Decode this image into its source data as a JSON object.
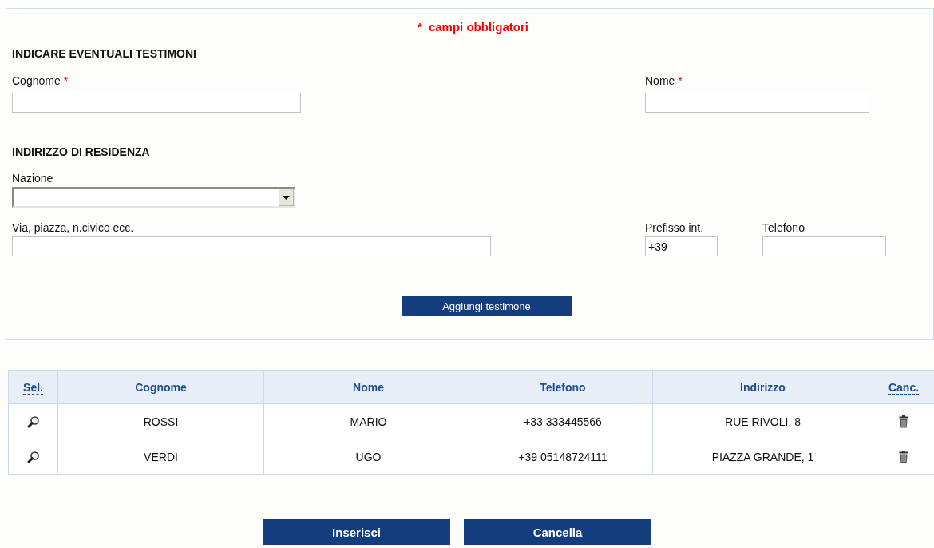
{
  "required_note": {
    "mark": "*",
    "text": "campi obbligatori"
  },
  "witness_section": {
    "title": "INDICARE EVENTUALI TESTIMONI",
    "fields": [
      {
        "label": "Cognome",
        "required_mark": "*",
        "kind": "text"
      },
      {
        "label": "Nome",
        "required_mark": "*",
        "kind": "text"
      }
    ]
  },
  "address_section": {
    "title": "INDIRIZZO DI RESIDENZA",
    "fields": [
      {
        "label": "Nazione",
        "kind": "select"
      },
      {
        "label": "Via, piazza, n.civico ecc.",
        "kind": "text"
      },
      {
        "label": "Prefisso int.",
        "kind": "text",
        "value": "+39"
      },
      {
        "label": "Telefono",
        "kind": "text"
      }
    ]
  },
  "add_button": "Aggiungi testimone",
  "table": {
    "columns": [
      {
        "label": "Sel.",
        "kind": "abbr"
      },
      {
        "label": "Cognome",
        "kind": "plain"
      },
      {
        "label": "Nome",
        "kind": "plain"
      },
      {
        "label": "Telefono",
        "kind": "plain"
      },
      {
        "label": "Indirizzo",
        "kind": "plain"
      },
      {
        "label": "Canc.",
        "kind": "abbr"
      }
    ],
    "rows": [
      {
        "cognome": "ROSSI",
        "nome": "MARIO",
        "telefono": "+33 333445566",
        "indirizzo": "RUE RIVOLI, 8"
      },
      {
        "cognome": "VERDI",
        "nome": "UGO",
        "telefono": "+39 05148724111",
        "indirizzo": "PIAZZA GRANDE, 1"
      }
    ]
  },
  "buttons": [
    "Inserisci",
    "Cancella"
  ]
}
